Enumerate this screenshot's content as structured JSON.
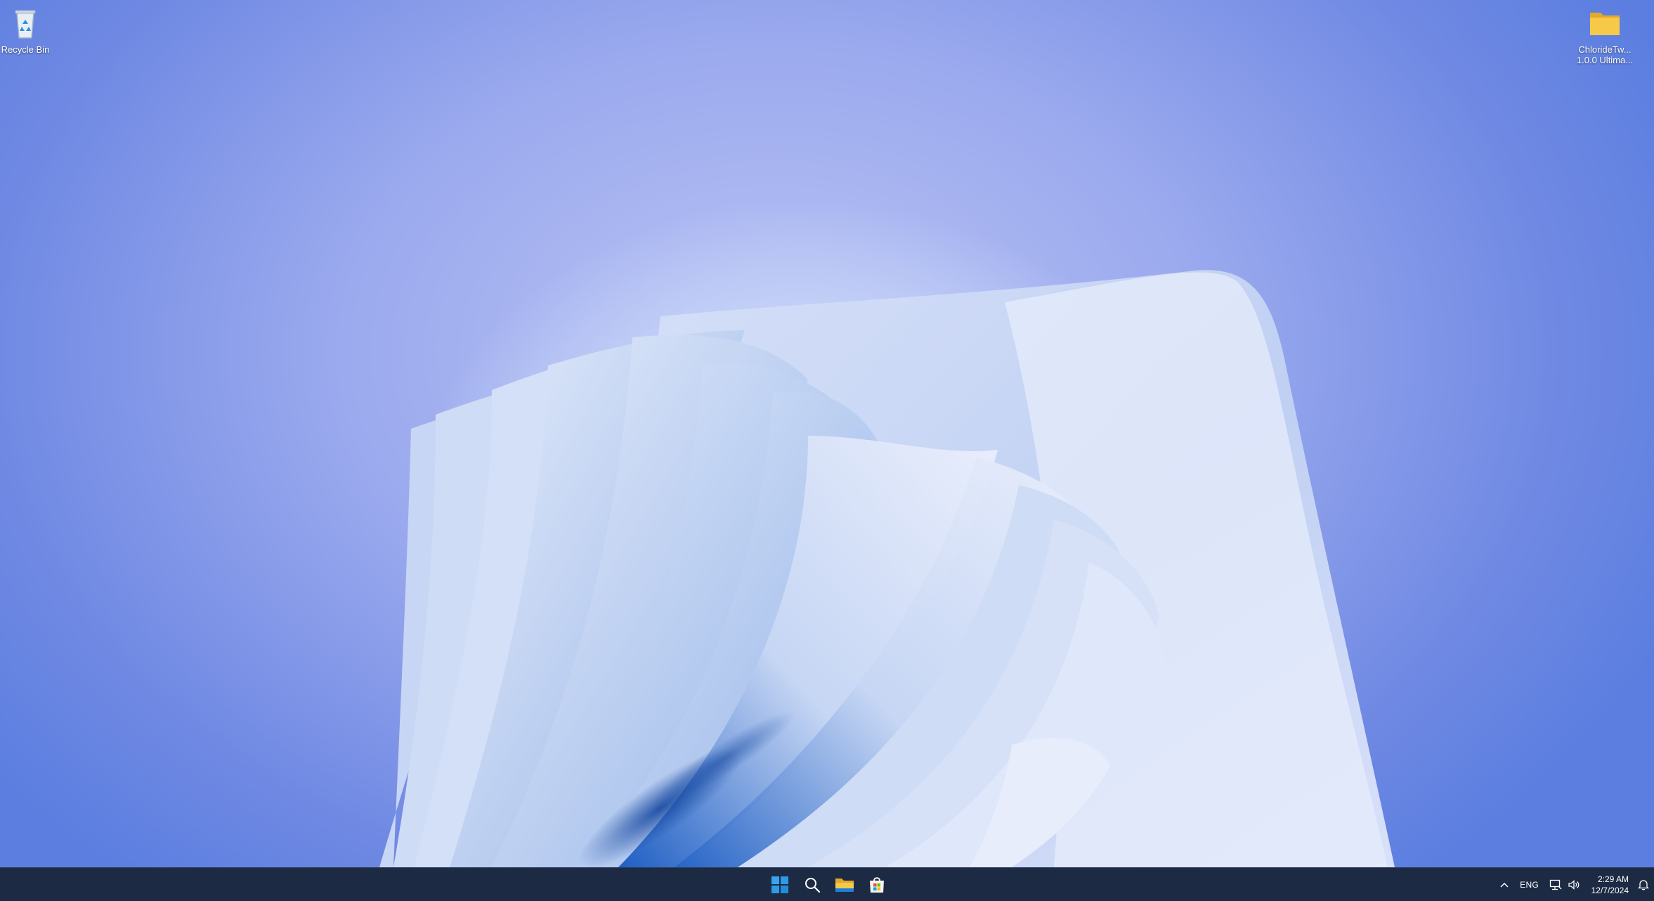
{
  "desktop": {
    "icons": [
      {
        "name": "Recycle Bin",
        "icon": "recycle-bin-icon"
      },
      {
        "name_line1": "ChlorideTw...",
        "name_line2": "1.0.0 Ultima...",
        "icon": "folder-icon"
      }
    ]
  },
  "taskbar": {
    "apps": [
      {
        "id": "start",
        "icon": "windows-logo-icon"
      },
      {
        "id": "search",
        "icon": "search-icon"
      },
      {
        "id": "file-explorer",
        "icon": "file-explorer-icon"
      },
      {
        "id": "store",
        "icon": "microsoft-store-icon"
      }
    ],
    "tray": {
      "overflow_icon": "chevron-up-icon",
      "language": "ENG",
      "network_icon": "network-icon",
      "volume_icon": "volume-icon",
      "time": "2:29 AM",
      "date": "12/7/2024",
      "notification_icon": "notification-bell-icon"
    }
  },
  "colors": {
    "taskbar_bg": "#1d2a44",
    "wallpaper_base": "#7f95e8",
    "windows_blue": "#2b9be8",
    "folder_yellow": "#f6c948"
  }
}
